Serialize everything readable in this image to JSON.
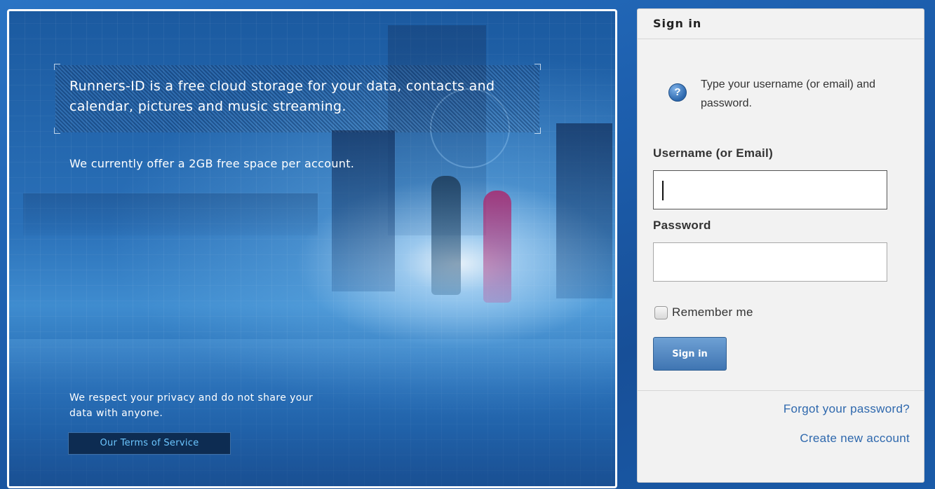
{
  "hero": {
    "headline": "Runners-ID is a free cloud storage for your data, contacts and calendar, pictures and music streaming.",
    "offer": "We currently offer a 2GB free space per account.",
    "privacy": "We respect your privacy and do not share your data with anyone.",
    "terms_link": "Our Terms of Service"
  },
  "signin": {
    "title": "Sign in",
    "help_icon": "question-circle-icon",
    "help_text": "Type your username (or email) and password.",
    "username_label": "Username (or Email)",
    "username_value": "",
    "password_label": "Password",
    "password_value": "",
    "remember_label": "Remember me",
    "remember_checked": false,
    "submit_label": "Sign in",
    "forgot_link": "Forgot your password?",
    "create_link": "Create new account"
  },
  "colors": {
    "background": "#1d5fae",
    "panel": "#f2f2f2",
    "link": "#2e68ad",
    "button": "#3f75b2",
    "terms_bg": "#0d2c52",
    "terms_text": "#6cc6ff"
  }
}
